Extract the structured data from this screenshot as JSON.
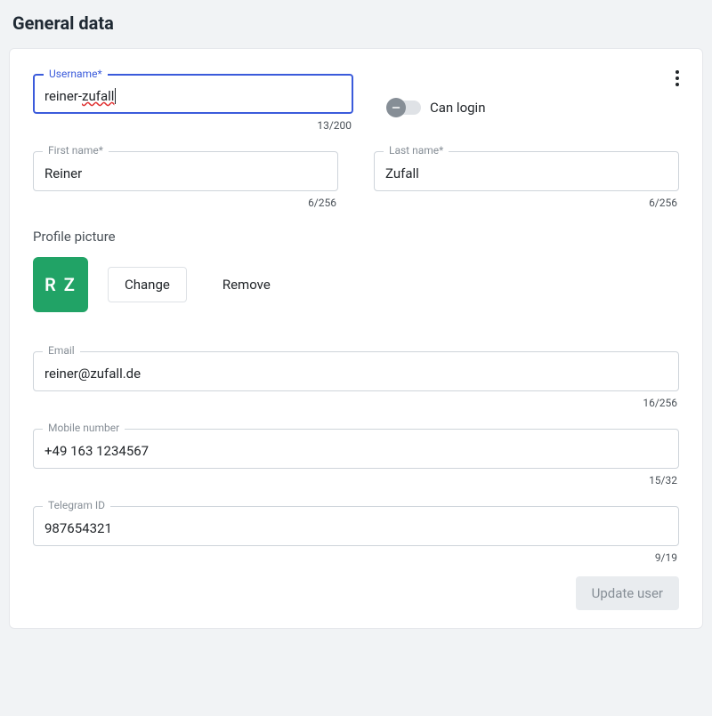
{
  "page": {
    "title": "General data"
  },
  "fields": {
    "username": {
      "label": "Username*",
      "value_plain": "reiner-",
      "value_spell": "zufall",
      "counter": "13/200"
    },
    "can_login": {
      "label": "Can login",
      "checked": false
    },
    "first_name": {
      "label": "First name*",
      "value": "Reiner",
      "counter": "6/256"
    },
    "last_name": {
      "label": "Last name*",
      "value": "Zufall",
      "counter": "6/256"
    },
    "profile_picture": {
      "label": "Profile picture",
      "initials": "R Z",
      "change": "Change",
      "remove": "Remove"
    },
    "email": {
      "label": "Email",
      "value": "reiner@zufall.de",
      "counter": "16/256"
    },
    "mobile": {
      "label": "Mobile number",
      "value": "+49 163 1234567",
      "counter": "15/32"
    },
    "telegram": {
      "label": "Telegram ID",
      "value": "987654321",
      "counter": "9/19"
    }
  },
  "actions": {
    "update": "Update user"
  }
}
